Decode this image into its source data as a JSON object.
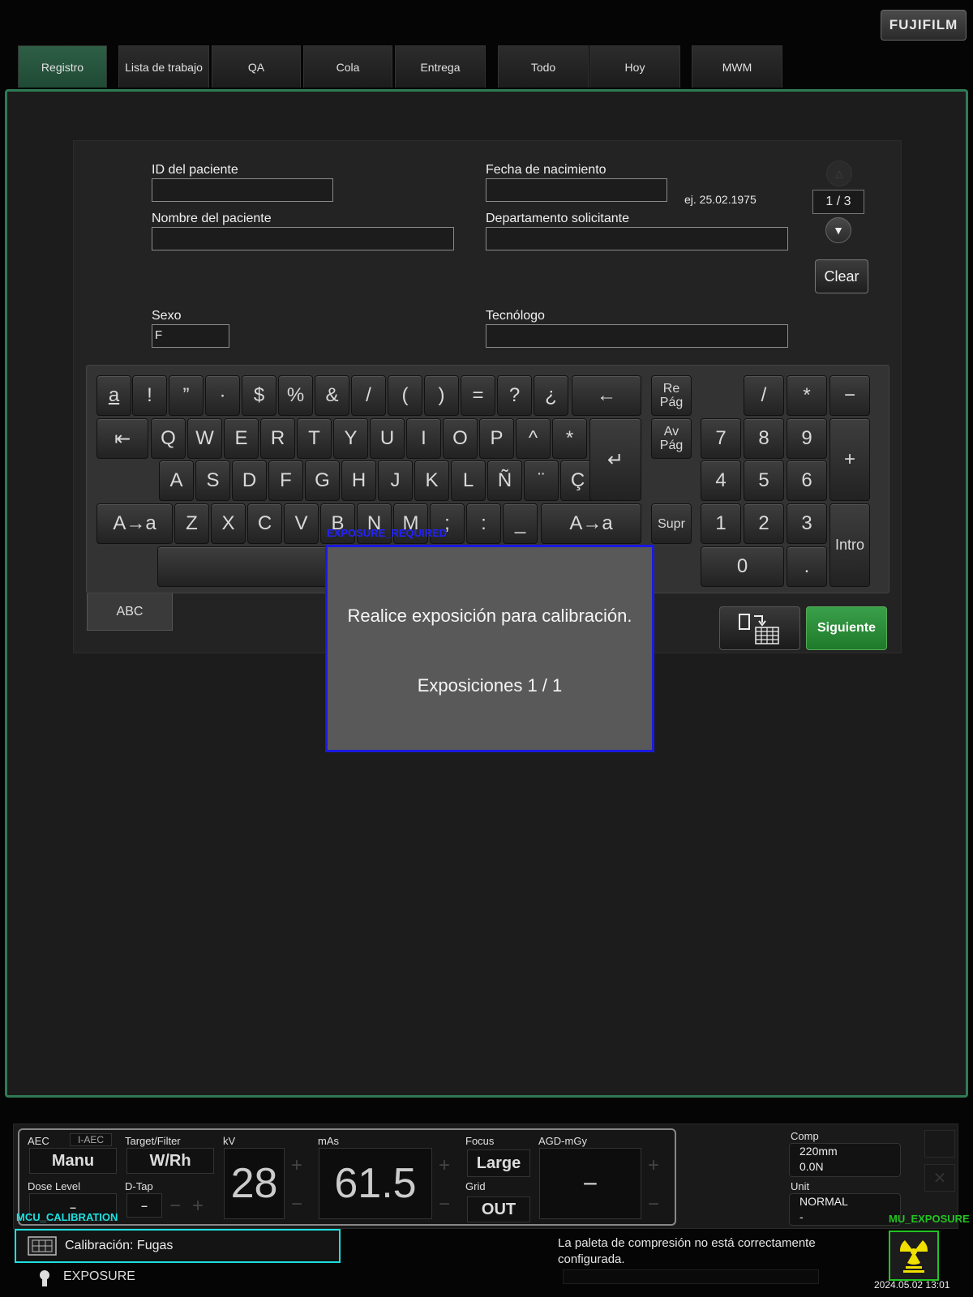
{
  "brand": "FUJIFILM",
  "tabs": [
    "Registro",
    "Lista de trabajo",
    "QA",
    "Cola",
    "Entrega",
    "Todo",
    "Hoy",
    "MWM"
  ],
  "form": {
    "patient_id_label": "ID del paciente",
    "patient_id_value": "",
    "birth_label": "Fecha de nacimiento",
    "birth_value": "",
    "birth_hint": "ej. 25.02.1975",
    "patient_name_label": "Nombre del paciente",
    "patient_name_value": "",
    "dept_label": "Departamento solicitante",
    "dept_value": "",
    "sex_label": "Sexo",
    "sex_value": "F",
    "tech_label": "Tecnólogo",
    "tech_value": ""
  },
  "paging": {
    "indicator": "1 / 3",
    "clear": "Clear"
  },
  "keyboard": {
    "row1": [
      "a",
      "!",
      "”",
      "·",
      "$",
      "%",
      "&",
      "/",
      "(",
      ")",
      "=",
      "?",
      "¿",
      "←"
    ],
    "row2": [
      "⇤",
      "Q",
      "W",
      "E",
      "R",
      "T",
      "Y",
      "U",
      "I",
      "O",
      "P",
      "^",
      "*"
    ],
    "row3": [
      "A",
      "S",
      "D",
      "F",
      "G",
      "H",
      "J",
      "K",
      "L",
      "Ñ",
      "¨",
      "Ç"
    ],
    "row4": [
      "A→a",
      "Z",
      "X",
      "C",
      "V",
      "B",
      "N",
      "M",
      ";",
      ":",
      "_",
      "A→a"
    ],
    "pgup": "Re Pág",
    "pgdn": "Av Pág",
    "del": "Supr",
    "enter": "↵",
    "numpad": {
      "ops": [
        "/",
        "*",
        "−",
        "+"
      ],
      "digits": [
        "7",
        "8",
        "9",
        "4",
        "5",
        "6",
        "1",
        "2",
        "3",
        "0",
        "."
      ],
      "enter": "Intro"
    },
    "mode_tab": "ABC"
  },
  "next_button": "Siguiente",
  "dialog": {
    "tag": "EXPOSURE_REQUIRED",
    "message": "Realice exposición para calibración.",
    "count": "Exposiciones 1 / 1"
  },
  "console": {
    "aec_label": "AEC",
    "aec_mode": "I-AEC",
    "aec_value": "Manu",
    "target_label": "Target/Filter",
    "target_value": "W/Rh",
    "kv_label": "kV",
    "kv_value": "28",
    "mas_label": "mAs",
    "mas_value": "61.5",
    "focus_label": "Focus",
    "focus_value": "Large",
    "grid_label": "Grid",
    "grid_value": "OUT",
    "agd_label": "AGD-mGy",
    "agd_value": "−",
    "dose_label": "Dose Level",
    "dose_value": "–",
    "dtap_label": "D-Tap",
    "dtap_value": "–",
    "comp_label": "Comp",
    "comp_thickness": "220mm",
    "comp_force": "0.0N",
    "unit_label": "Unit",
    "unit_value": "NORMAL",
    "unit_sub": "-"
  },
  "status": {
    "mcu_tag": "MCU_CALIBRATION",
    "calibration": "Calibración: Fugas",
    "message": "La paleta de compresión no está correctamente configurada.",
    "mu_tag": "MU_EXPOSURE",
    "exposure": "EXPOSURE",
    "datetime": "2024.05.02 13:01"
  },
  "colors": {
    "accent_green": "#2f7a55",
    "next_green": "#2a9a3a",
    "dialog_border": "#1a1ae0",
    "cyan_tag": "#1ee0e0",
    "exposure_yellow": "#f0e000"
  }
}
